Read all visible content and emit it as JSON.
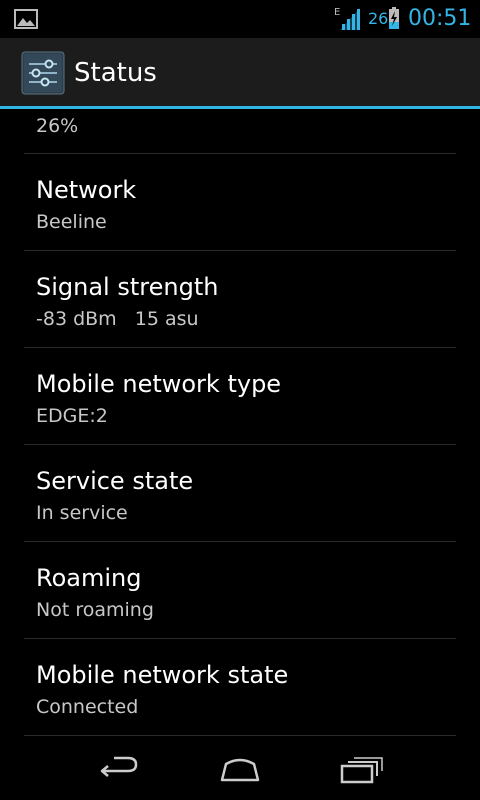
{
  "status_bar": {
    "network_type_indicator": "E",
    "battery_level": "26",
    "time": "00:51",
    "accent_color": "#33b5e5",
    "icons": [
      "gallery-notification-icon",
      "signal-icon",
      "battery-charging-icon"
    ]
  },
  "action_bar": {
    "title": "Status",
    "icon": "settings-app-icon"
  },
  "list": {
    "partial_top_value": "26%",
    "items": [
      {
        "title": "Network",
        "value": "Beeline"
      },
      {
        "title": "Signal strength",
        "value": "-83 dBm   15 asu"
      },
      {
        "title": "Mobile network type",
        "value": "EDGE:2"
      },
      {
        "title": "Service state",
        "value": "In service"
      },
      {
        "title": "Roaming",
        "value": "Not roaming"
      },
      {
        "title": "Mobile network state",
        "value": "Connected"
      }
    ]
  },
  "nav_bar": {
    "buttons": [
      "back-icon",
      "home-icon",
      "recent-apps-icon"
    ]
  }
}
